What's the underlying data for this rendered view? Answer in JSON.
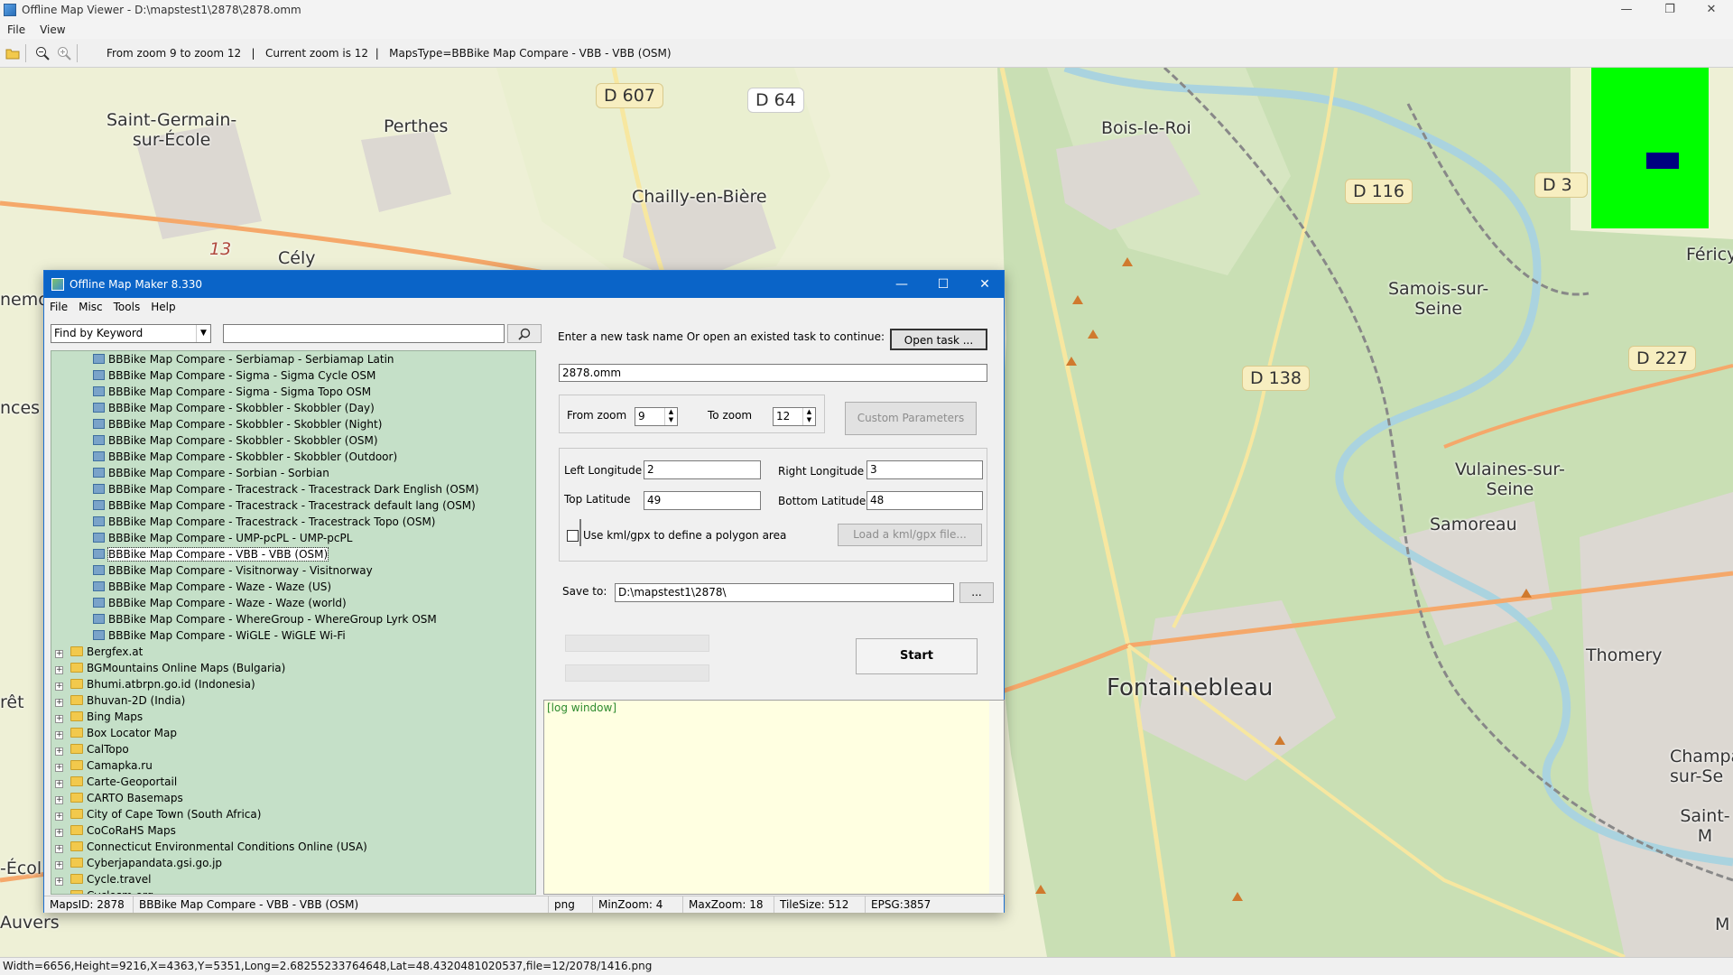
{
  "outer": {
    "title": "Offline Map Viewer - D:\\mapstest1\\2878\\2878.omm",
    "menu": [
      "File",
      "View"
    ],
    "toolbar_status": "From zoom 9 to zoom 12   |   Current zoom is 12  |   MapsType=BBBike Map Compare - VBB - VBB (OSM)",
    "bottom_status": "Width=6656,Height=9216,X=4363,Y=5351,Long=2.68255233764648,Lat=48.4320481020537,file=12/2078/1416.png"
  },
  "map": {
    "labels": {
      "saint_germain": "Saint-Germain-\nsur-École",
      "perthes": "Perthes",
      "chailly": "Chailly-en-Bière",
      "cely": "Cély",
      "bois_le_roi": "Bois-le-Roi",
      "samois": "Samois-sur-\nSeine",
      "vulaines": "Vulaines-sur-\nSeine",
      "samoreau": "Samoreau",
      "fontainebleau": "Fontainebleau",
      "thomery": "Thomery",
      "champagne": "Champa\nsur-Se",
      "saint_m": "Saint-M",
      "ferics": "Féricy",
      "emo": "nemo",
      "nces": "nces",
      "ret": "rêt",
      "ecol": "-Écol",
      "auvers": "Auvers",
      "m_right": "M",
      "thirteen": "13"
    },
    "shields": {
      "d607": "D 607",
      "d64": "D 64",
      "d116": "D 116",
      "d3": "D 3",
      "d138": "D 138",
      "d227": "D 227"
    },
    "colors": {
      "forest": "#c9dfb4",
      "field": "#eef0d6",
      "urban": "#dcd8d2",
      "water": "#aad3df",
      "road_major": "#f5a86a",
      "road_minor": "#f7e7a0"
    }
  },
  "dialog": {
    "title": "Offline Map Maker 8.330",
    "menu": [
      "File",
      "Misc",
      "Tools",
      "Help"
    ],
    "search_mode": "Find by Keyword",
    "search_value": "",
    "tree_leaves": [
      "BBBike Map Compare - Serbiamap - Serbiamap Latin",
      "BBBike Map Compare - Sigma - Sigma Cycle OSM",
      "BBBike Map Compare - Sigma - Sigma Topo OSM",
      "BBBike Map Compare - Skobbler - Skobbler (Day)",
      "BBBike Map Compare - Skobbler - Skobbler (Night)",
      "BBBike Map Compare - Skobbler - Skobbler (OSM)",
      "BBBike Map Compare - Skobbler - Skobbler (Outdoor)",
      "BBBike Map Compare - Sorbian - Sorbian",
      "BBBike Map Compare - Tracestrack - Tracestrack Dark English (OSM)",
      "BBBike Map Compare - Tracestrack - Tracestrack default lang (OSM)",
      "BBBike Map Compare - Tracestrack - Tracestrack Topo (OSM)",
      "BBBike Map Compare - UMP-pcPL - UMP-pcPL",
      "BBBike Map Compare - VBB - VBB (OSM)",
      "BBBike Map Compare - Visitnorway - Visitnorway",
      "BBBike Map Compare - Waze - Waze (US)",
      "BBBike Map Compare - Waze - Waze (world)",
      "BBBike Map Compare - WhereGroup - WhereGroup Lyrk OSM",
      "BBBike Map Compare - WiGLE - WiGLE Wi-Fi"
    ],
    "selected_leaf_index": 12,
    "tree_folders": [
      "Bergfex.at",
      "BGMountains Online Maps (Bulgaria)",
      "Bhumi.atbrpn.go.id (Indonesia)",
      "Bhuvan-2D (India)",
      "Bing Maps",
      "Box Locator Map",
      "CalTopo",
      "Camapka.ru",
      "Carte-Geoportail",
      "CARTO Basemaps",
      "City of Cape Town (South Africa)",
      "CoCoRaHS Maps",
      "Connecticut Environmental Conditions Online (USA)",
      "Cyberjapandata.gsi.go.jp",
      "Cycle.travel",
      "Cyclosm.org"
    ],
    "task_prompt": "Enter a new task name Or open an existed task to continue:",
    "open_task_label": "Open task ...",
    "task_name": "2878.omm",
    "from_zoom_label": "From zoom",
    "from_zoom": "9",
    "to_zoom_label": "To zoom",
    "to_zoom": "12",
    "custom_params_label": "Custom Parameters",
    "left_lon_label": "Left Longitude",
    "left_lon": "2",
    "right_lon_label": "Right Longitude",
    "right_lon": "3",
    "top_lat_label": "Top Latitude",
    "top_lat": "49",
    "bottom_lat_label": "Bottom Latitude",
    "bottom_lat": "48",
    "kml_label": "Use kml/gpx to define a polygon area",
    "kml_checked": false,
    "load_kml_label": "Load a kml/gpx file...",
    "save_to_label": "Save to:",
    "save_to": "D:\\mapstest1\\2878\\",
    "browse_label": "...",
    "start_label": "Start",
    "log_text": "[log window]",
    "status": {
      "maps_id": "MapsID: 2878",
      "maps_name": "BBBike Map Compare - VBB - VBB (OSM)",
      "format": "png",
      "min_zoom": "MinZoom: 4",
      "max_zoom": "MaxZoom: 18",
      "tile_size": "TileSize: 512",
      "epsg": "EPSG:3857"
    }
  }
}
